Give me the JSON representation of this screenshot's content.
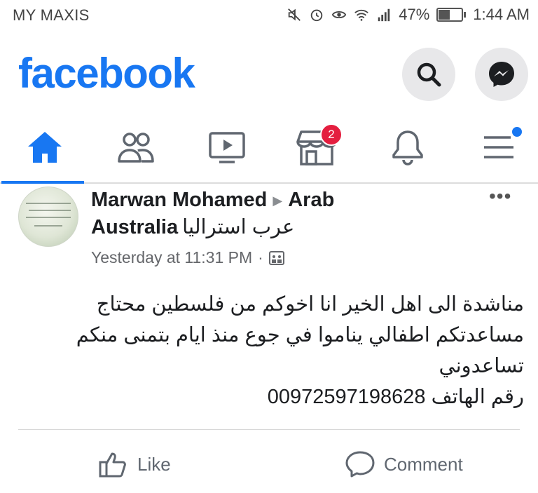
{
  "status_bar": {
    "carrier": "MY MAXIS",
    "battery": "47%",
    "battery_level": 0.47,
    "time": "1:44 AM"
  },
  "header": {
    "logo": "facebook",
    "brand_color": "#1877f2"
  },
  "tabs": [
    {
      "name": "home",
      "icon": "home-icon",
      "active": true
    },
    {
      "name": "friends",
      "icon": "friends-icon"
    },
    {
      "name": "watch",
      "icon": "video-icon"
    },
    {
      "name": "marketplace",
      "icon": "store-icon",
      "badge": "2"
    },
    {
      "name": "notifications",
      "icon": "bell-icon"
    },
    {
      "name": "menu",
      "icon": "menu-icon",
      "dot": true
    }
  ],
  "post": {
    "author": "Marwan Mohamed",
    "group_en": "Arab Australia",
    "group_ar": "عرب استراليا",
    "timestamp": "Yesterday at 11:31 PM",
    "separator": "·",
    "more": "•••",
    "body_lines": [
      "مناشدة الى اهل الخير انا اخوكم من فلسطين محتاج",
      "مساعدتكم اطفالي يناموا في جوع منذ ايام بتمنى منكم",
      "تساعدوني",
      "رقم الهاتف 00972597198628"
    ],
    "like_label": "Like",
    "comment_label": "Comment"
  }
}
